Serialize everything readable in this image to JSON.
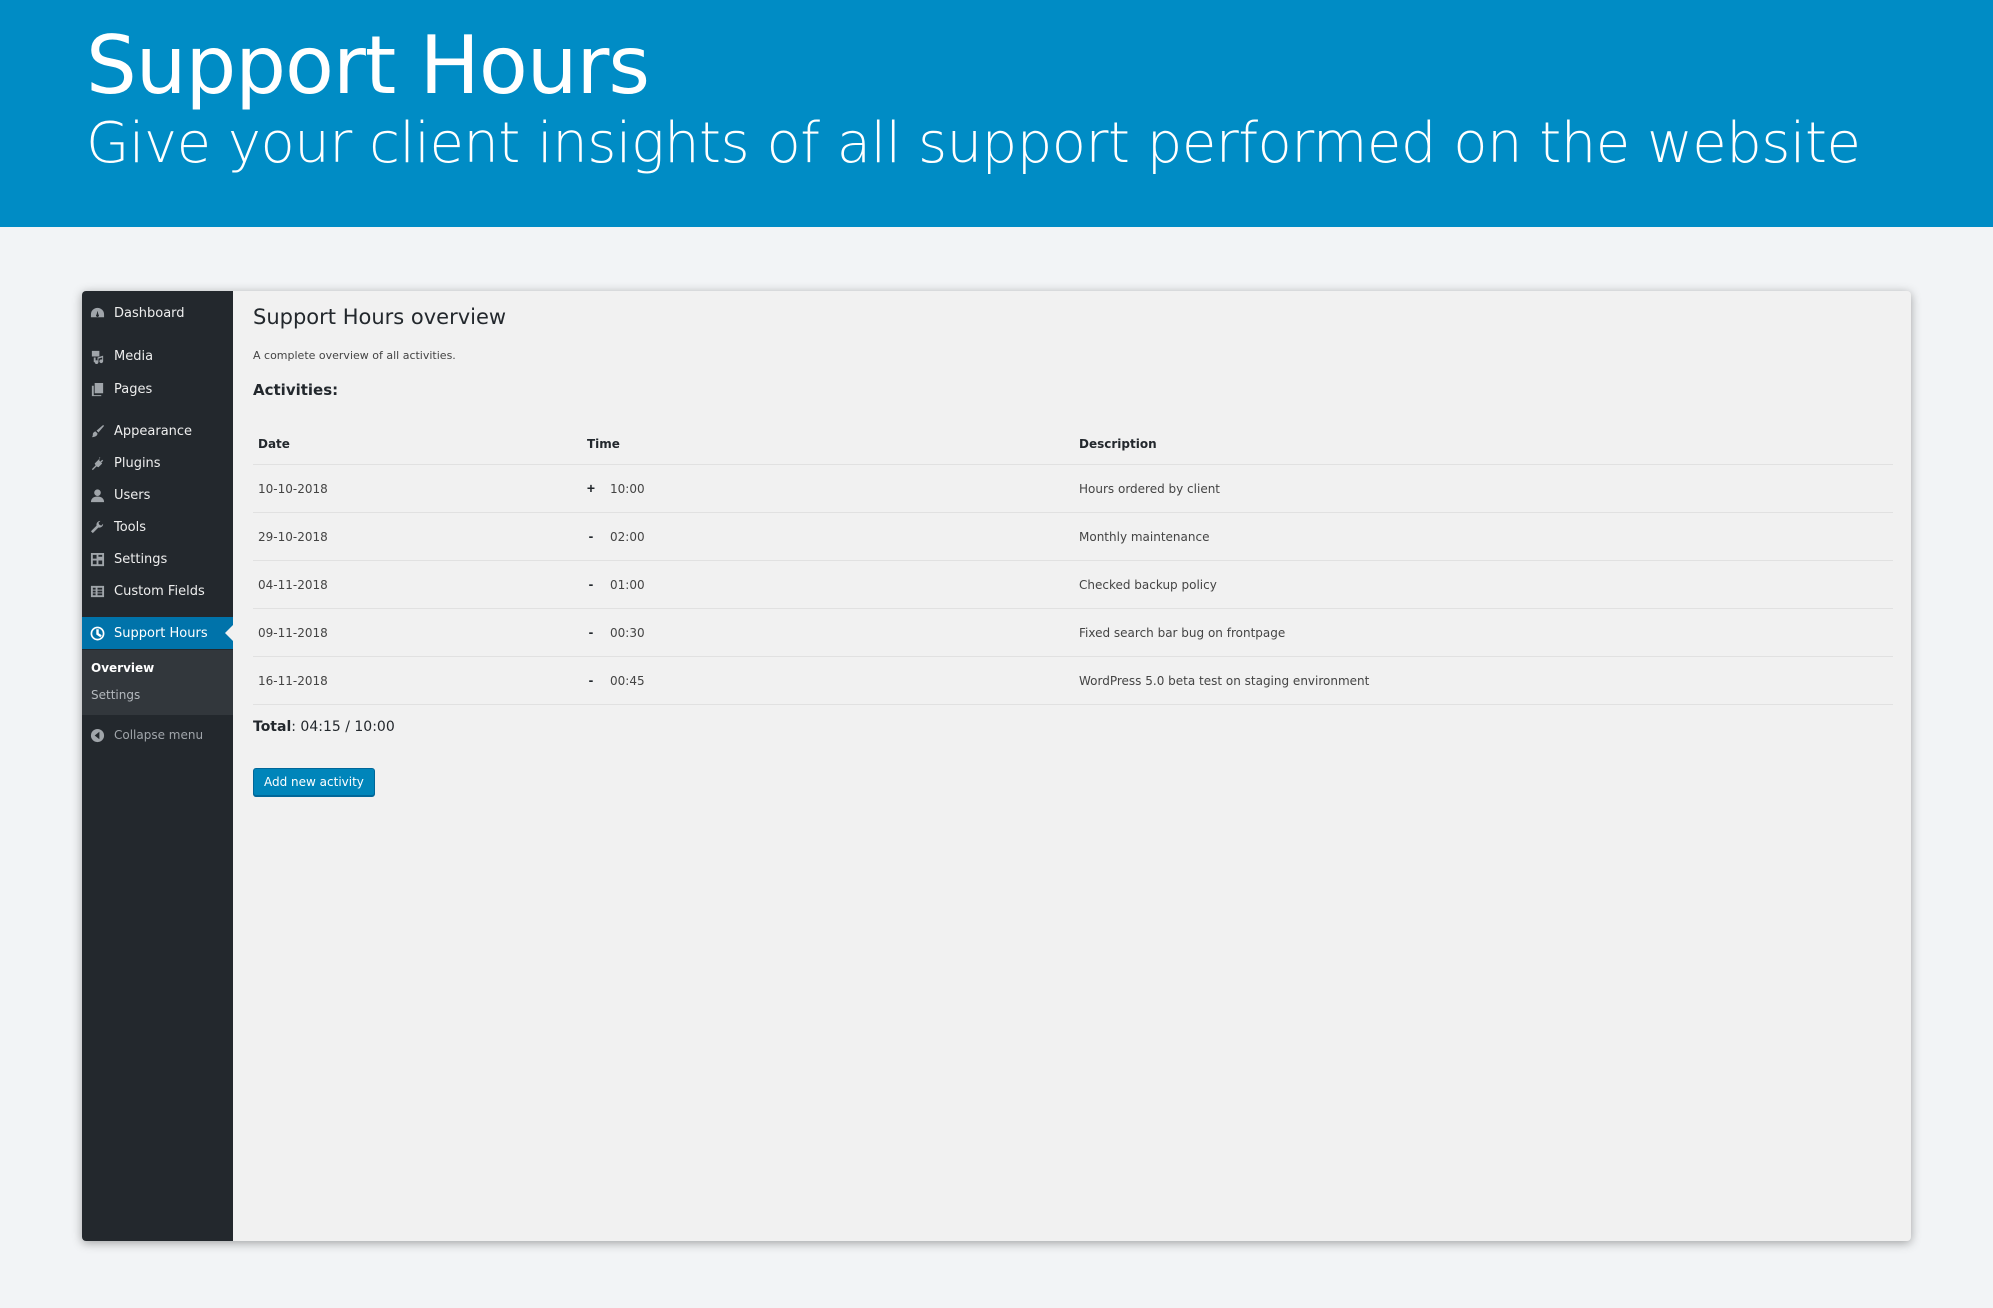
{
  "banner": {
    "title": "Support Hours",
    "subtitle": "Give your client insights of all support performed on the website"
  },
  "sidebar": {
    "items": [
      {
        "label": "Dashboard",
        "icon": "dashboard-icon"
      },
      {
        "label": "Media",
        "icon": "media-icon"
      },
      {
        "label": "Pages",
        "icon": "pages-icon"
      },
      {
        "label": "Appearance",
        "icon": "appearance-icon"
      },
      {
        "label": "Plugins",
        "icon": "plugins-icon"
      },
      {
        "label": "Users",
        "icon": "users-icon"
      },
      {
        "label": "Tools",
        "icon": "tools-icon"
      },
      {
        "label": "Settings",
        "icon": "settings-icon"
      },
      {
        "label": "Custom Fields",
        "icon": "custom-fields-icon"
      },
      {
        "label": "Support Hours",
        "icon": "clock-icon",
        "active": true
      }
    ],
    "submenu": [
      {
        "label": "Overview",
        "current": true
      },
      {
        "label": "Settings",
        "current": false
      }
    ],
    "collapse_label": "Collapse menu",
    "active_color": "#0073aa",
    "background": "#23282d"
  },
  "main": {
    "title": "Support Hours overview",
    "description": "A complete overview of all activities.",
    "section_label": "Activities:",
    "table": {
      "headers": [
        "Date",
        "Time",
        "Description"
      ],
      "rows": [
        {
          "date": "10-10-2018",
          "sign": "+",
          "time": "10:00",
          "description": "Hours ordered by client"
        },
        {
          "date": "29-10-2018",
          "sign": "-",
          "time": "02:00",
          "description": "Monthly maintenance"
        },
        {
          "date": "04-11-2018",
          "sign": "-",
          "time": "01:00",
          "description": "Checked backup policy"
        },
        {
          "date": "09-11-2018",
          "sign": "-",
          "time": "00:30",
          "description": "Fixed search bar bug on frontpage"
        },
        {
          "date": "16-11-2018",
          "sign": "-",
          "time": "00:45",
          "description": "WordPress 5.0 beta test on staging environment"
        }
      ]
    },
    "total_label": "Total",
    "total_value": ": 04:15 / 10:00",
    "add_button_label": "Add new activity"
  }
}
